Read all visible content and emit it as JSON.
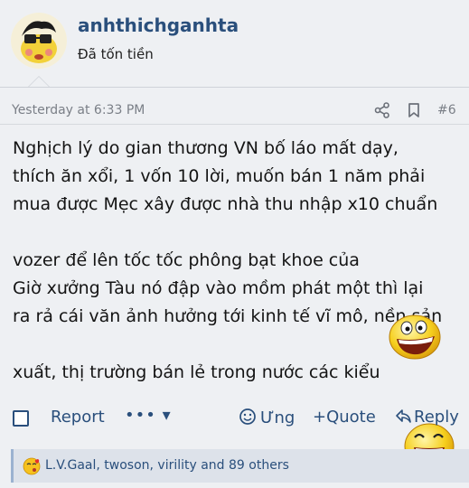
{
  "user": {
    "username": "anhthichganhta",
    "title": "Đã tốn tiền"
  },
  "post": {
    "timestamp": "Yesterday at 6:33 PM",
    "number": "#6",
    "lines": [
      "Nghịch lý do gian thương VN bố láo mất dạy,",
      "thích ăn xổi, 1 vốn 10 lời, muốn bán 1 năm phải",
      "mua được Mẹc xây được nhà thu nhập x10 chuẩn",
      "",
      "vozer để lên tốc tốc phông bạt khoe của",
      "Giờ xưởng Tàu nó đập vào mồm phát một thì lại",
      "ra rả cái văn ảnh hưởng tới kinh tế vĩ mô, nền sản",
      "",
      "xuất, thị trường bán lẻ trong nước các kiểu"
    ]
  },
  "actions": {
    "report": "Report",
    "more": "••• ▾",
    "react": "Ưng",
    "quote": "+Quote",
    "reply": "Reply"
  },
  "reactions": {
    "text": "L.V.Gaal, twoson, virility and 89 others"
  },
  "colors": {
    "link": "#2a4f7c",
    "meta": "#7a7f87",
    "background": "#eef0f3"
  },
  "icons": [
    "share-icon",
    "bookmark-icon",
    "react-icon",
    "reply-arrow-icon",
    "kiss-emoji-icon",
    "grin-emoji-icon",
    "laugh-emoji-icon"
  ]
}
